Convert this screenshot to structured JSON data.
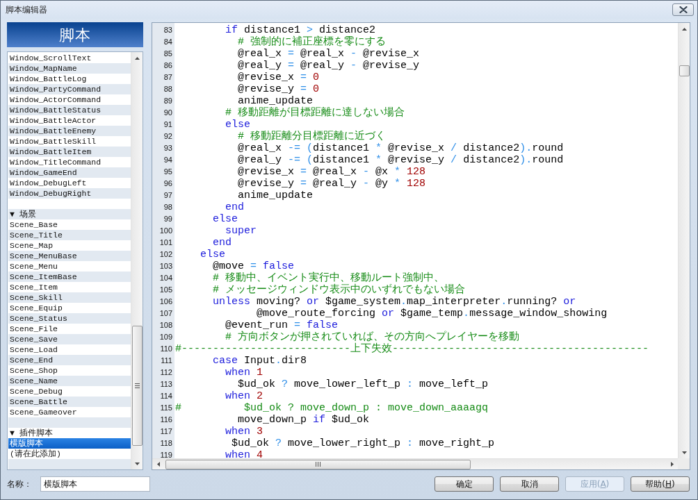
{
  "window": {
    "title": "脚本编辑器"
  },
  "script_list": {
    "header": "脚本",
    "items": [
      {
        "kind": "script",
        "label": "Window_ScrollText",
        "selected": false
      },
      {
        "kind": "script",
        "label": "Window_MapName",
        "selected": false
      },
      {
        "kind": "script",
        "label": "Window_BattleLog",
        "selected": false
      },
      {
        "kind": "script",
        "label": "Window_PartyCommand",
        "selected": false
      },
      {
        "kind": "script",
        "label": "Window_ActorCommand",
        "selected": false
      },
      {
        "kind": "script",
        "label": "Window_BattleStatus",
        "selected": false
      },
      {
        "kind": "script",
        "label": "Window_BattleActor",
        "selected": false
      },
      {
        "kind": "script",
        "label": "Window_BattleEnemy",
        "selected": false
      },
      {
        "kind": "script",
        "label": "Window_BattleSkill",
        "selected": false
      },
      {
        "kind": "script",
        "label": "Window_BattleItem",
        "selected": false
      },
      {
        "kind": "script",
        "label": "Window_TitleCommand",
        "selected": false
      },
      {
        "kind": "script",
        "label": "Window_GameEnd",
        "selected": false
      },
      {
        "kind": "script",
        "label": "Window_DebugLeft",
        "selected": false
      },
      {
        "kind": "script",
        "label": "Window_DebugRight",
        "selected": false
      },
      {
        "kind": "blank",
        "selected": false
      },
      {
        "kind": "script",
        "label": "▼ 场景",
        "selected": false
      },
      {
        "kind": "script",
        "label": "Scene_Base",
        "selected": false
      },
      {
        "kind": "script",
        "label": "Scene_Title",
        "selected": false
      },
      {
        "kind": "script",
        "label": "Scene_Map",
        "selected": false
      },
      {
        "kind": "script",
        "label": "Scene_MenuBase",
        "selected": false
      },
      {
        "kind": "script",
        "label": "Scene_Menu",
        "selected": false
      },
      {
        "kind": "script",
        "label": "Scene_ItemBase",
        "selected": false
      },
      {
        "kind": "script",
        "label": "Scene_Item",
        "selected": false
      },
      {
        "kind": "script",
        "label": "Scene_Skill",
        "selected": false
      },
      {
        "kind": "script",
        "label": "Scene_Equip",
        "selected": false
      },
      {
        "kind": "script",
        "label": "Scene_Status",
        "selected": false
      },
      {
        "kind": "script",
        "label": "Scene_File",
        "selected": false
      },
      {
        "kind": "script",
        "label": "Scene_Save",
        "selected": false
      },
      {
        "kind": "script",
        "label": "Scene_Load",
        "selected": false
      },
      {
        "kind": "script",
        "label": "Scene_End",
        "selected": false
      },
      {
        "kind": "script",
        "label": "Scene_Shop",
        "selected": false
      },
      {
        "kind": "script",
        "label": "Scene_Name",
        "selected": false
      },
      {
        "kind": "script",
        "label": "Scene_Debug",
        "selected": false
      },
      {
        "kind": "script",
        "label": "Scene_Battle",
        "selected": false
      },
      {
        "kind": "script",
        "label": "Scene_Gameover",
        "selected": false
      },
      {
        "kind": "blank",
        "selected": false
      },
      {
        "kind": "script",
        "label": "▼ 插件脚本",
        "selected": false
      },
      {
        "kind": "script",
        "label": "横版脚本",
        "selected": true
      },
      {
        "kind": "script",
        "label": "(请在此添加)",
        "selected": false
      },
      {
        "kind": "blank",
        "selected": false
      }
    ]
  },
  "editor": {
    "lines": [
      {
        "number": "83",
        "tokens": [
          {
            "kind": "keyword",
            "text": "        if"
          },
          {
            "kind": "plain",
            "text": " distance1 "
          },
          {
            "kind": "operator",
            "text": ">"
          },
          {
            "kind": "plain",
            "text": " distance2"
          }
        ]
      },
      {
        "number": "84",
        "tokens": [
          {
            "kind": "comment",
            "text": "          # 強制的に補正座標を零にする"
          }
        ]
      },
      {
        "number": "85",
        "tokens": [
          {
            "kind": "plain",
            "text": "          @real_x "
          },
          {
            "kind": "operator",
            "text": "="
          },
          {
            "kind": "plain",
            "text": " @real_x "
          },
          {
            "kind": "operator",
            "text": "-"
          },
          {
            "kind": "plain",
            "text": " @revise_x"
          }
        ]
      },
      {
        "number": "86",
        "tokens": [
          {
            "kind": "plain",
            "text": "          @real_y "
          },
          {
            "kind": "operator",
            "text": "="
          },
          {
            "kind": "plain",
            "text": " @real_y "
          },
          {
            "kind": "operator",
            "text": "-"
          },
          {
            "kind": "plain",
            "text": " @revise_y"
          }
        ]
      },
      {
        "number": "87",
        "tokens": [
          {
            "kind": "plain",
            "text": "          @revise_x "
          },
          {
            "kind": "operator",
            "text": "="
          },
          {
            "kind": "number",
            "text": " 0"
          }
        ]
      },
      {
        "number": "88",
        "tokens": [
          {
            "kind": "plain",
            "text": "          @revise_y "
          },
          {
            "kind": "operator",
            "text": "="
          },
          {
            "kind": "number",
            "text": " 0"
          }
        ]
      },
      {
        "number": "89",
        "tokens": [
          {
            "kind": "plain",
            "text": "          anime_update"
          }
        ]
      },
      {
        "number": "90",
        "tokens": [
          {
            "kind": "comment",
            "text": "        # 移動距離が目標距離に達しない場合"
          }
        ]
      },
      {
        "number": "91",
        "tokens": [
          {
            "kind": "keyword",
            "text": "        else"
          }
        ]
      },
      {
        "number": "92",
        "tokens": [
          {
            "kind": "comment",
            "text": "          # 移動距離分目標距離に近づく"
          }
        ]
      },
      {
        "number": "93",
        "tokens": [
          {
            "kind": "plain",
            "text": "          @real_x "
          },
          {
            "kind": "operator",
            "text": "-= ("
          },
          {
            "kind": "plain",
            "text": "distance1 "
          },
          {
            "kind": "operator",
            "text": "*"
          },
          {
            "kind": "plain",
            "text": " @revise_x "
          },
          {
            "kind": "operator",
            "text": "/"
          },
          {
            "kind": "plain",
            "text": " distance2"
          },
          {
            "kind": "operator",
            "text": ")."
          },
          {
            "kind": "plain",
            "text": "round"
          }
        ]
      },
      {
        "number": "94",
        "tokens": [
          {
            "kind": "plain",
            "text": "          @real_y "
          },
          {
            "kind": "operator",
            "text": "-= ("
          },
          {
            "kind": "plain",
            "text": "distance1 "
          },
          {
            "kind": "operator",
            "text": "*"
          },
          {
            "kind": "plain",
            "text": " @revise_y "
          },
          {
            "kind": "operator",
            "text": "/"
          },
          {
            "kind": "plain",
            "text": " distance2"
          },
          {
            "kind": "operator",
            "text": ")."
          },
          {
            "kind": "plain",
            "text": "round"
          }
        ]
      },
      {
        "number": "95",
        "tokens": [
          {
            "kind": "plain",
            "text": "          @revise_x "
          },
          {
            "kind": "operator",
            "text": "="
          },
          {
            "kind": "plain",
            "text": " @real_x "
          },
          {
            "kind": "operator",
            "text": "-"
          },
          {
            "kind": "plain",
            "text": " @x "
          },
          {
            "kind": "operator",
            "text": "*"
          },
          {
            "kind": "number",
            "text": " 128"
          }
        ]
      },
      {
        "number": "96",
        "tokens": [
          {
            "kind": "plain",
            "text": "          @revise_y "
          },
          {
            "kind": "operator",
            "text": "="
          },
          {
            "kind": "plain",
            "text": " @real_y "
          },
          {
            "kind": "operator",
            "text": "-"
          },
          {
            "kind": "plain",
            "text": " @y "
          },
          {
            "kind": "operator",
            "text": "*"
          },
          {
            "kind": "number",
            "text": " 128"
          }
        ]
      },
      {
        "number": "97",
        "tokens": [
          {
            "kind": "plain",
            "text": "          anime_update"
          }
        ]
      },
      {
        "number": "98",
        "tokens": [
          {
            "kind": "keyword",
            "text": "        end"
          }
        ]
      },
      {
        "number": "99",
        "tokens": [
          {
            "kind": "keyword",
            "text": "      else"
          }
        ]
      },
      {
        "number": "100",
        "tokens": [
          {
            "kind": "keyword",
            "text": "        super"
          }
        ]
      },
      {
        "number": "101",
        "tokens": [
          {
            "kind": "keyword",
            "text": "      end"
          }
        ]
      },
      {
        "number": "102",
        "tokens": [
          {
            "kind": "keyword",
            "text": "    else"
          }
        ]
      },
      {
        "number": "103",
        "tokens": [
          {
            "kind": "plain",
            "text": "      @move "
          },
          {
            "kind": "operator",
            "text": "="
          },
          {
            "kind": "keyword",
            "text": " false"
          }
        ]
      },
      {
        "number": "104",
        "tokens": [
          {
            "kind": "comment",
            "text": "      # 移動中、イベント実行中、移動ルート強制中、"
          }
        ]
      },
      {
        "number": "105",
        "tokens": [
          {
            "kind": "comment",
            "text": "      # メッセージウィンドウ表示中のいずれでもない場合"
          }
        ]
      },
      {
        "number": "106",
        "tokens": [
          {
            "kind": "keyword",
            "text": "      unless"
          },
          {
            "kind": "plain",
            "text": " moving? "
          },
          {
            "kind": "keyword",
            "text": "or"
          },
          {
            "kind": "plain",
            "text": " $game_system"
          },
          {
            "kind": "operator",
            "text": "."
          },
          {
            "kind": "plain",
            "text": "map_interpreter"
          },
          {
            "kind": "operator",
            "text": "."
          },
          {
            "kind": "plain",
            "text": "running? "
          },
          {
            "kind": "keyword",
            "text": "or"
          }
        ]
      },
      {
        "number": "107",
        "tokens": [
          {
            "kind": "plain",
            "text": "             @move_route_forcing "
          },
          {
            "kind": "keyword",
            "text": "or"
          },
          {
            "kind": "plain",
            "text": " $game_temp"
          },
          {
            "kind": "operator",
            "text": "."
          },
          {
            "kind": "plain",
            "text": "message_window_showing"
          }
        ]
      },
      {
        "number": "108",
        "tokens": [
          {
            "kind": "plain",
            "text": "        @event_run "
          },
          {
            "kind": "operator",
            "text": "="
          },
          {
            "kind": "keyword",
            "text": " false"
          }
        ]
      },
      {
        "number": "109",
        "tokens": [
          {
            "kind": "comment",
            "text": "        # 方向ボタンが押されていれば、その方向へプレイヤーを移動"
          }
        ]
      },
      {
        "number": "110",
        "tokens": [
          {
            "kind": "comment",
            "text": "#---------------------------上下失效-----------------------------------------"
          }
        ]
      },
      {
        "number": "111",
        "tokens": [
          {
            "kind": "keyword",
            "text": "      case"
          },
          {
            "kind": "plain",
            "text": " Input"
          },
          {
            "kind": "operator",
            "text": "."
          },
          {
            "kind": "plain",
            "text": "dir8"
          }
        ]
      },
      {
        "number": "112",
        "tokens": [
          {
            "kind": "keyword",
            "text": "        when"
          },
          {
            "kind": "number",
            "text": " 1"
          }
        ]
      },
      {
        "number": "113",
        "tokens": [
          {
            "kind": "plain",
            "text": "          $ud_ok "
          },
          {
            "kind": "operator",
            "text": "?"
          },
          {
            "kind": "plain",
            "text": " move_lower_left_p "
          },
          {
            "kind": "operator",
            "text": ":"
          },
          {
            "kind": "plain",
            "text": " move_left_p"
          }
        ]
      },
      {
        "number": "114",
        "tokens": [
          {
            "kind": "keyword",
            "text": "        when"
          },
          {
            "kind": "number",
            "text": " 2"
          }
        ]
      },
      {
        "number": "115",
        "tokens": [
          {
            "kind": "comment",
            "text": "#          $ud_ok ? move_down_p : move_down_aaaagq"
          }
        ]
      },
      {
        "number": "116",
        "tokens": [
          {
            "kind": "plain",
            "text": "          move_down_p "
          },
          {
            "kind": "keyword",
            "text": "if"
          },
          {
            "kind": "plain",
            "text": " $ud_ok"
          }
        ]
      },
      {
        "number": "117",
        "tokens": [
          {
            "kind": "keyword",
            "text": "        when"
          },
          {
            "kind": "number",
            "text": " 3"
          }
        ]
      },
      {
        "number": "118",
        "tokens": [
          {
            "kind": "plain",
            "text": "         $ud_ok "
          },
          {
            "kind": "operator",
            "text": "?"
          },
          {
            "kind": "plain",
            "text": " move_lower_right_p "
          },
          {
            "kind": "operator",
            "text": ":"
          },
          {
            "kind": "plain",
            "text": " move_right_p"
          }
        ]
      },
      {
        "number": "119",
        "tokens": [
          {
            "kind": "keyword",
            "text": "        when"
          },
          {
            "kind": "number",
            "text": " 4"
          }
        ]
      }
    ]
  },
  "name_field": {
    "label": "名称：",
    "value": "横版脚本"
  },
  "buttons": [
    {
      "label": "确定",
      "disabled": false
    },
    {
      "label": "取消",
      "disabled": false
    },
    {
      "label": "应用(A)",
      "disabled": true
    },
    {
      "label": "帮助(H)",
      "disabled": false
    }
  ]
}
